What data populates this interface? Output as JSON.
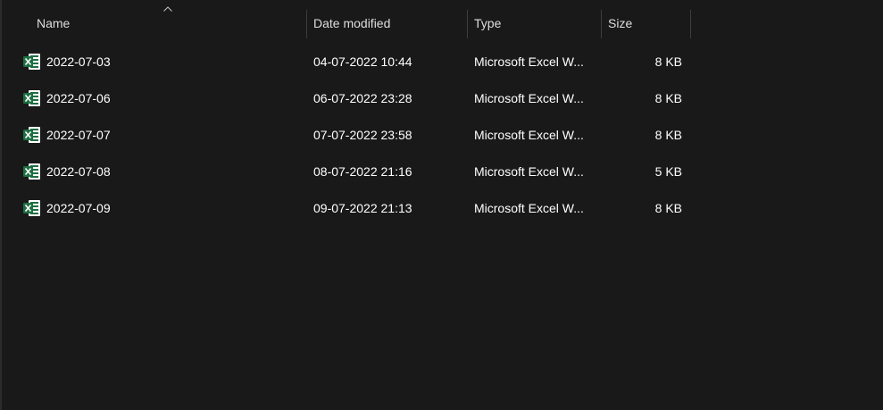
{
  "columns": {
    "name": "Name",
    "date_modified": "Date modified",
    "type": "Type",
    "size": "Size"
  },
  "sort": {
    "column": "name",
    "direction": "ascending",
    "icon": "chevron-up-icon"
  },
  "file_icon": "excel-file-icon",
  "colors": {
    "background": "#191919",
    "excel_green": "#1d6f42",
    "text": "#ffffff",
    "header_text": "#dedede"
  },
  "files": [
    {
      "name": "2022-07-03",
      "date_modified": "04-07-2022 10:44",
      "type": "Microsoft Excel W...",
      "size": "8 KB"
    },
    {
      "name": "2022-07-06",
      "date_modified": "06-07-2022 23:28",
      "type": "Microsoft Excel W...",
      "size": "8 KB"
    },
    {
      "name": "2022-07-07",
      "date_modified": "07-07-2022 23:58",
      "type": "Microsoft Excel W...",
      "size": "8 KB"
    },
    {
      "name": "2022-07-08",
      "date_modified": "08-07-2022 21:16",
      "type": "Microsoft Excel W...",
      "size": "5 KB"
    },
    {
      "name": "2022-07-09",
      "date_modified": "09-07-2022 21:13",
      "type": "Microsoft Excel W...",
      "size": "8 KB"
    }
  ]
}
